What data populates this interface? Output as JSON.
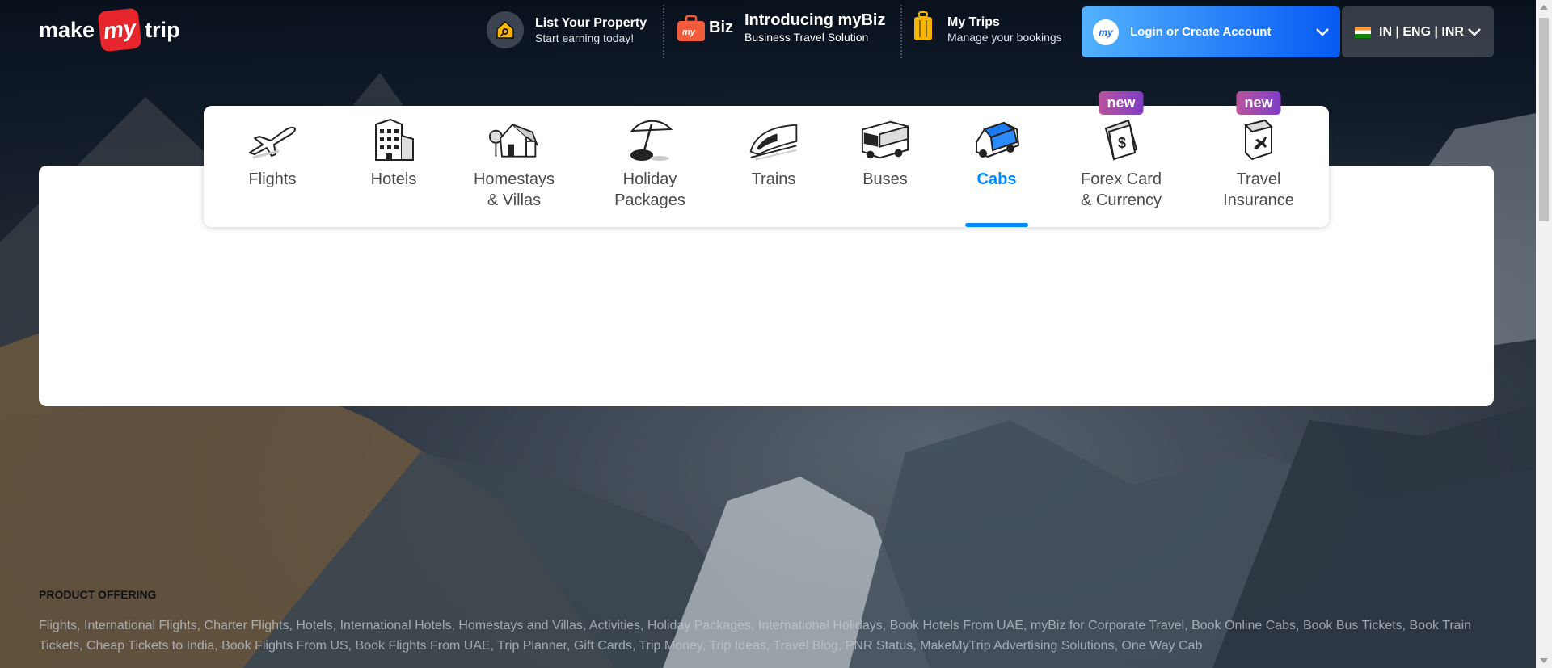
{
  "brand": {
    "left": "make",
    "mid": "my",
    "right": "trip"
  },
  "header": {
    "list_property": {
      "title": "List Your Property",
      "subtitle": "Start earning today!"
    },
    "mybiz": {
      "logo_text": "Biz",
      "title": "Introducing myBiz",
      "subtitle": "Business Travel Solution"
    },
    "my_trips": {
      "title": "My Trips",
      "subtitle": "Manage your bookings"
    },
    "login": {
      "avatar": "my",
      "label": "Login or Create Account"
    },
    "locale": {
      "label": "IN | ENG | INR"
    }
  },
  "nav": {
    "tabs": [
      {
        "id": "flights",
        "lines": [
          "Flights"
        ],
        "icon": "airplane-icon"
      },
      {
        "id": "hotels",
        "lines": [
          "Hotels"
        ],
        "icon": "building-icon"
      },
      {
        "id": "homestays",
        "lines": [
          "Homestays",
          "& Villas"
        ],
        "icon": "house-icon"
      },
      {
        "id": "holiday",
        "lines": [
          "Holiday",
          "Packages"
        ],
        "icon": "beach-umbrella-icon"
      },
      {
        "id": "trains",
        "lines": [
          "Trains"
        ],
        "icon": "train-icon"
      },
      {
        "id": "buses",
        "lines": [
          "Buses"
        ],
        "icon": "bus-icon"
      },
      {
        "id": "cabs",
        "lines": [
          "Cabs"
        ],
        "icon": "car-icon",
        "active": true
      },
      {
        "id": "forex",
        "lines": [
          "Forex Card",
          "& Currency"
        ],
        "icon": "forex-card-icon",
        "badge": "new"
      },
      {
        "id": "insurance",
        "lines": [
          "Travel",
          "Insurance"
        ],
        "icon": "insurance-shield-icon",
        "badge": "new"
      }
    ]
  },
  "footer": {
    "title": "PRODUCT OFFERING",
    "links": "Flights, International Flights, Charter Flights, Hotels, International Hotels, Homestays and Villas, Activities, Holiday Packages, International Holidays, Book Hotels From UAE, myBiz for Corporate Travel, Book Online Cabs, Book Bus Tickets, Book Train Tickets, Cheap Tickets to India, Book Flights From US, Book Flights From UAE, Trip Planner, Gift Cards, Trip Money, Trip Ideas, Travel Blog, PNR Status, MakeMyTrip Advertising Solutions, One Way Cab"
  },
  "colors": {
    "accent": "#008cff",
    "brand_red": "#e7252d",
    "login_start": "#53b2fe",
    "login_end": "#065af3"
  }
}
